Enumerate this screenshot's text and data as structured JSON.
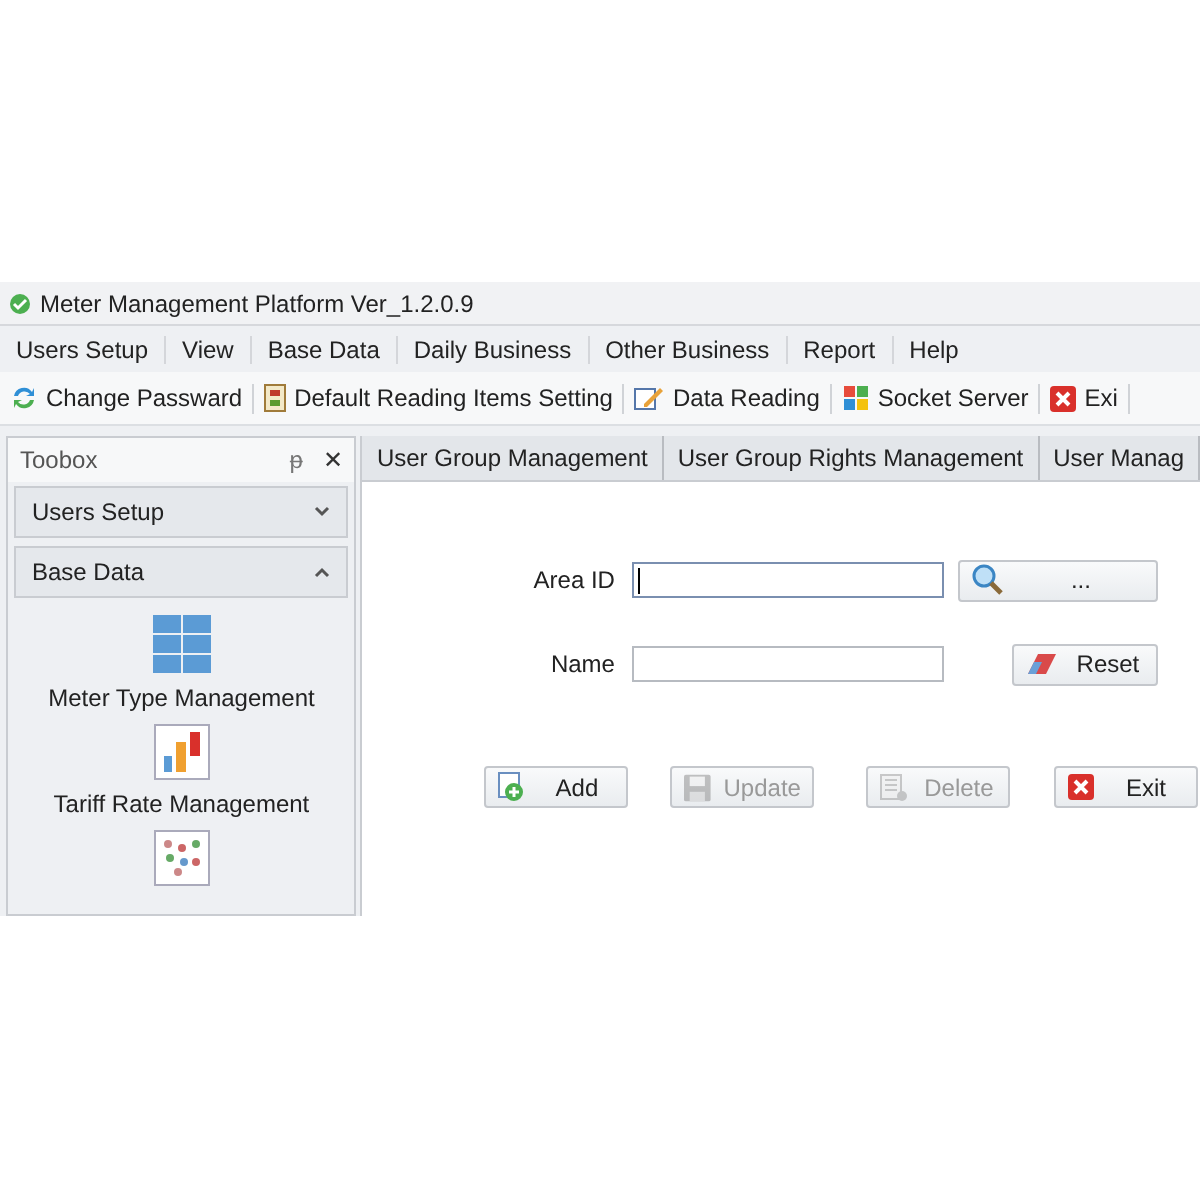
{
  "window": {
    "title": "Meter Management Platform Ver_1.2.0.9"
  },
  "menu": [
    "Users Setup",
    "View",
    "Base Data",
    "Daily Business",
    "Other Business",
    "Report",
    "Help"
  ],
  "toolbar": [
    {
      "label": "Change Passward",
      "kind": "refresh"
    },
    {
      "label": "Default Reading Items Setting",
      "kind": "doc"
    },
    {
      "label": "Data Reading",
      "kind": "edit"
    },
    {
      "label": "Socket Server",
      "kind": "windows"
    },
    {
      "label": "Exi",
      "kind": "exit"
    }
  ],
  "toolbox": {
    "title": "Toobox",
    "pin": "ᵽ",
    "close": "✕",
    "sections": [
      {
        "label": "Users Setup",
        "expanded": false
      },
      {
        "label": "Base Data",
        "expanded": true,
        "items": [
          {
            "label": "Meter Type Management",
            "kind": "grid"
          },
          {
            "label": "Tariff Rate Management",
            "kind": "bars"
          },
          {
            "kind": "dots"
          }
        ]
      }
    ]
  },
  "tabs": [
    {
      "label": "User Group Management",
      "selected": false
    },
    {
      "label": "User Group Rights Management",
      "selected": false
    },
    {
      "label": "User Manag",
      "selected": false
    }
  ],
  "form": {
    "fields": [
      {
        "label": "Area ID",
        "focused": true,
        "button": {
          "label": "...",
          "kind": "search"
        }
      },
      {
        "label": "Name",
        "focused": false,
        "button": {
          "label": "Reset",
          "kind": "eraser"
        }
      }
    ],
    "buttons": [
      {
        "label": "Add",
        "kind": "add",
        "disabled": false
      },
      {
        "label": "Update",
        "kind": "save",
        "disabled": true
      },
      {
        "label": "Delete",
        "kind": "delete",
        "disabled": true
      },
      {
        "label": "Exit",
        "kind": "exit",
        "disabled": false
      }
    ]
  }
}
